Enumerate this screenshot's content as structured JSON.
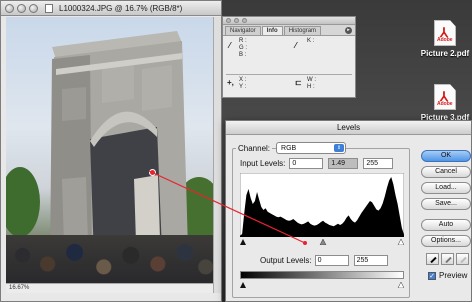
{
  "desktop": {
    "files": [
      {
        "label": "Picture 2.pdf",
        "icon": "pdf-file-icon"
      },
      {
        "label": "Picture 3.pdf",
        "icon": "pdf-file-icon"
      }
    ]
  },
  "document": {
    "title": "L1000324.JPG @ 16.7% (RGB/8*)",
    "zoom_status": "16.67%"
  },
  "info_palette": {
    "tabs": [
      "Navigator",
      "Info",
      "Histogram"
    ],
    "active_tab": "Info",
    "sample_labels": {
      "r": "R :",
      "g": "G :",
      "b": "B :",
      "k": "K :"
    },
    "position_labels": {
      "x": "X :",
      "y": "Y :",
      "w": "W :",
      "h": "H :"
    }
  },
  "levels": {
    "title": "Levels",
    "channel_label": "Channel:",
    "channel_value": "RGB",
    "input_label": "Input Levels:",
    "input_black": "0",
    "input_gamma": "1.49",
    "input_white": "255",
    "output_label": "Output Levels:",
    "output_black": "0",
    "output_white": "255",
    "histogram": [
      0.02,
      0.05,
      0.4,
      0.7,
      0.8,
      0.65,
      0.55,
      0.6,
      0.75,
      0.62,
      0.5,
      0.45,
      0.48,
      0.42,
      0.4,
      0.38,
      0.36,
      0.34,
      0.33,
      0.34,
      0.32,
      0.3,
      0.28,
      0.27,
      0.28,
      0.3,
      0.27,
      0.24,
      0.22,
      0.21,
      0.22,
      0.24,
      0.26,
      0.22,
      0.2,
      0.19,
      0.2,
      0.22,
      0.25,
      0.27,
      0.24,
      0.22,
      0.2,
      0.19,
      0.18,
      0.2,
      0.22,
      0.2,
      0.22,
      0.26,
      0.32,
      0.36,
      0.3,
      0.26,
      0.24,
      0.28,
      0.34,
      0.4,
      0.45,
      0.5,
      0.55,
      0.6,
      0.58,
      0.52,
      0.46,
      0.44,
      0.48,
      0.56,
      0.68,
      0.82,
      0.94,
      1.0,
      0.88,
      0.7,
      0.55,
      0.35,
      0.15,
      0.04
    ],
    "buttons": {
      "ok": "OK",
      "cancel": "Cancel",
      "load": "Load...",
      "save": "Save...",
      "auto": "Auto",
      "options": "Options..."
    },
    "preview_label": "Preview",
    "preview_checked": true
  }
}
